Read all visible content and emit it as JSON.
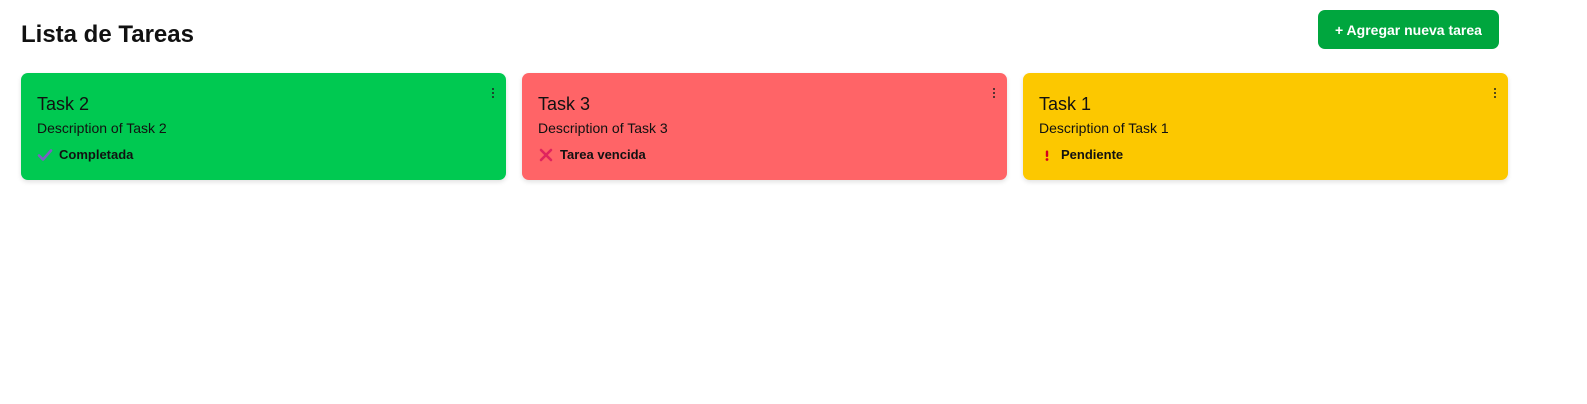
{
  "header": {
    "title": "Lista de Tareas",
    "add_button_label": "+ Agregar nueva tarea"
  },
  "colors": {
    "completed": "#00c951",
    "overdue": "#ff6467",
    "pending": "#fcc800",
    "add_button": "#00a63e",
    "check_icon": "#7b5fc4",
    "cross_icon": "#e0245e",
    "exclaim_icon": "#d6001c"
  },
  "tasks": [
    {
      "title": "Task 2",
      "description": "Description of Task 2",
      "status": "Completada",
      "status_icon": "check-icon"
    },
    {
      "title": "Task 3",
      "description": "Description of Task 3",
      "status": "Tarea vencida",
      "status_icon": "cross-icon"
    },
    {
      "title": "Task 1",
      "description": "Description of Task 1",
      "status": "Pendiente",
      "status_icon": "exclamation-icon"
    }
  ]
}
